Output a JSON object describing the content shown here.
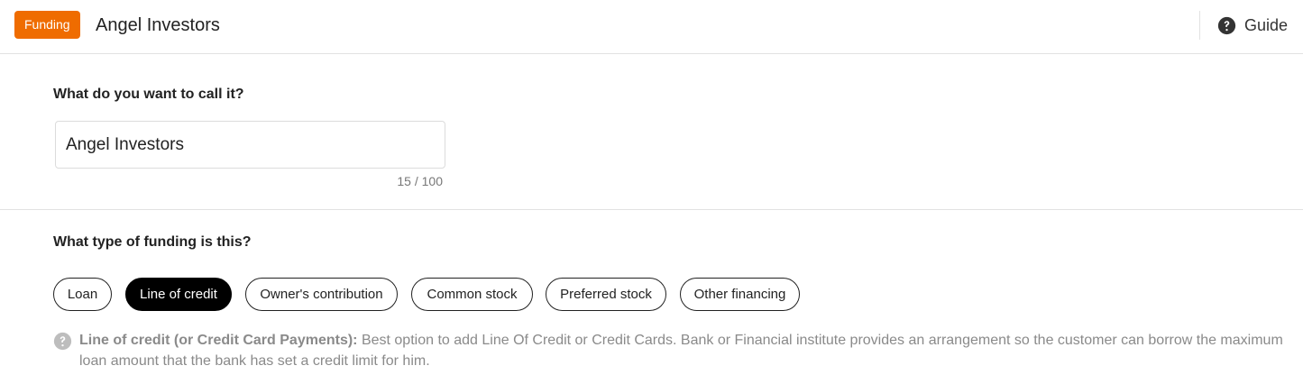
{
  "header": {
    "badge": "Funding",
    "title": "Angel Investors",
    "guide_label": "Guide",
    "badge_color": "#ef6c00"
  },
  "name_section": {
    "question": "What do you want to call it?",
    "input_value": "Angel Investors",
    "counter": "15 / 100"
  },
  "type_section": {
    "question": "What type of funding is this?",
    "options": [
      {
        "label": "Loan",
        "selected": false
      },
      {
        "label": "Line of credit",
        "selected": true
      },
      {
        "label": "Owner's contribution",
        "selected": false
      },
      {
        "label": "Common stock",
        "selected": false
      },
      {
        "label": "Preferred stock",
        "selected": false
      },
      {
        "label": "Other financing",
        "selected": false
      }
    ]
  },
  "help": {
    "icon": "question-circle-icon",
    "term": "Line of credit (or Credit Card Payments):",
    "description": " Best option to add Line Of Credit or Credit Cards. Bank or Financial institute provides an arrangement so the customer can borrow the maximum loan amount that the bank has set a credit limit for him."
  }
}
